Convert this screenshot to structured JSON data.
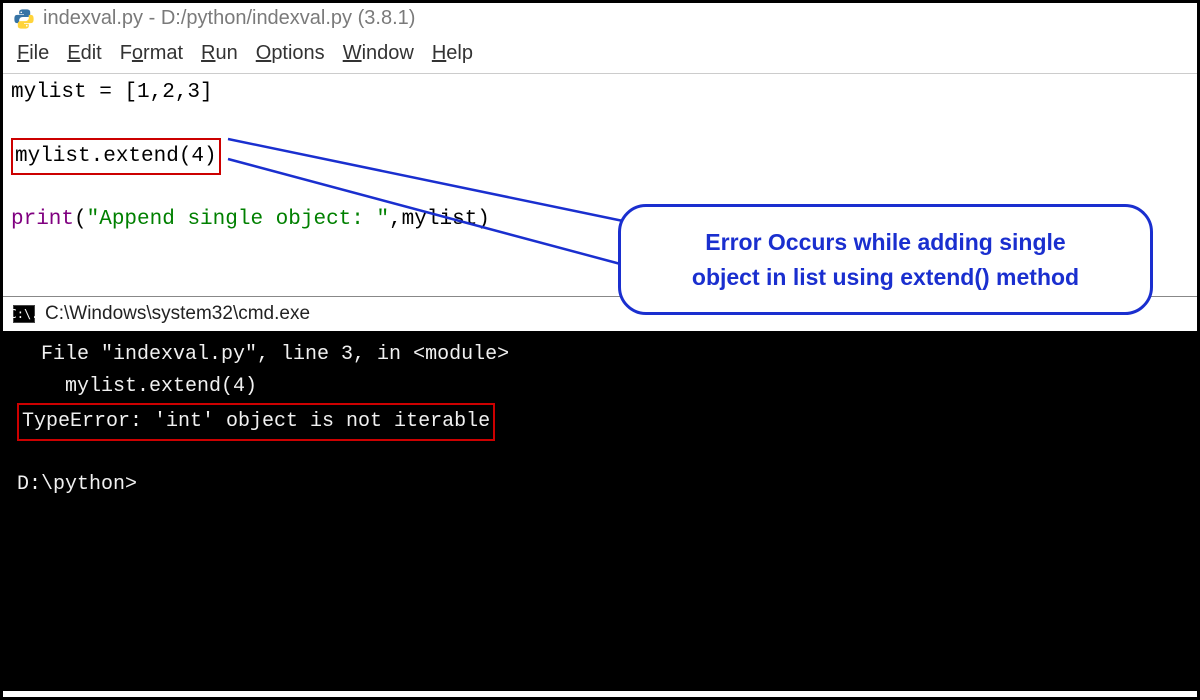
{
  "idle": {
    "title": "indexval.py - D:/python/indexval.py (3.8.1)"
  },
  "menu": {
    "file": "File",
    "edit": "Edit",
    "format": "Format",
    "run": "Run",
    "options": "Options",
    "window": "Window",
    "help": "Help"
  },
  "code": {
    "line1": "mylist = [1,2,3]",
    "line2": "mylist.extend(4)",
    "line3_print": "print",
    "line3_paren_open": "(",
    "line3_str": "\"Append single object: \"",
    "line3_rest": ",mylist)"
  },
  "callout": {
    "line1": "Error Occurs while adding single",
    "line2": "object in list using extend() method"
  },
  "cmd": {
    "title": "C:\\Windows\\system32\\cmd.exe",
    "icon_text": "C:\\."
  },
  "terminal": {
    "line1": "  File \"indexval.py\", line 3, in <module>",
    "line2": "    mylist.extend(4)",
    "error": "TypeError: 'int' object is not iterable",
    "prompt": "D:\\python>"
  }
}
